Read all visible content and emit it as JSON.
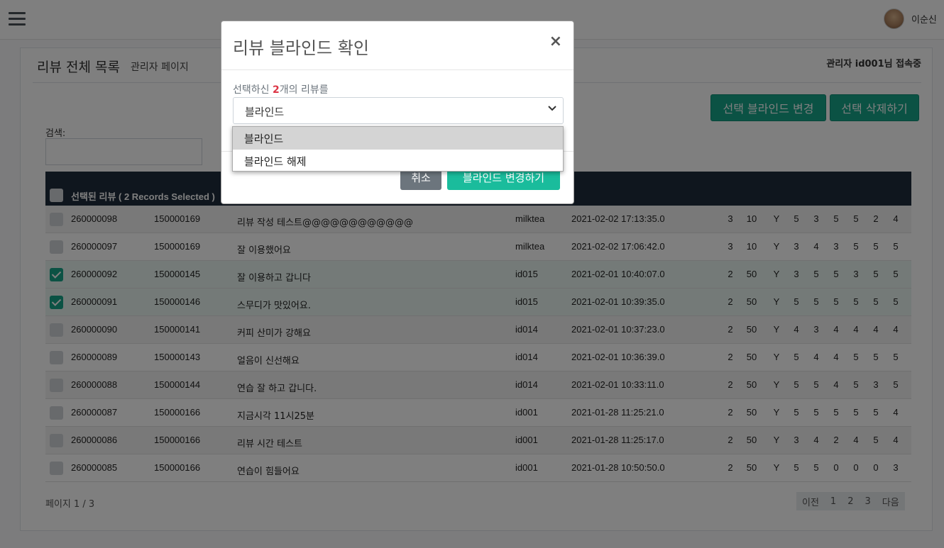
{
  "header": {
    "username": "이순신"
  },
  "page": {
    "title": "리뷰 전체 목록",
    "subtitle": "관리자 페이지",
    "admin_status": "관리자 id001님 접속중",
    "btn_blind_change": "선택 블라인드 변경",
    "btn_delete": "선택 삭제하기",
    "search_label": "검색:"
  },
  "table": {
    "header_label": "선택된 리뷰 ( 2 Records Selected )",
    "rows": [
      {
        "id": "260000098",
        "store": "150000169",
        "text": "리뷰 작성 테스트@@@@@@@@@@@@",
        "user": "milktea",
        "date": "2021-02-02 17:13:35.0",
        "n": [
          "3",
          "10",
          "Y",
          "5",
          "3",
          "5",
          "5",
          "2",
          "4"
        ],
        "selected": false
      },
      {
        "id": "260000097",
        "store": "150000169",
        "text": "잘 이용했어요",
        "user": "milktea",
        "date": "2021-02-02 17:06:42.0",
        "n": [
          "3",
          "10",
          "Y",
          "3",
          "4",
          "3",
          "5",
          "5",
          "5"
        ],
        "selected": false
      },
      {
        "id": "260000092",
        "store": "150000145",
        "text": "잘 이용하고 갑니다",
        "user": "id015",
        "date": "2021-02-01 10:40:07.0",
        "n": [
          "2",
          "50",
          "Y",
          "3",
          "5",
          "5",
          "3",
          "5",
          "5"
        ],
        "selected": true
      },
      {
        "id": "260000091",
        "store": "150000146",
        "text": "스무디가 맛있어요.",
        "user": "id015",
        "date": "2021-02-01 10:39:35.0",
        "n": [
          "2",
          "50",
          "Y",
          "5",
          "5",
          "5",
          "5",
          "5",
          "5"
        ],
        "selected": true
      },
      {
        "id": "260000090",
        "store": "150000141",
        "text": "커피 산미가 강해요",
        "user": "id014",
        "date": "2021-02-01 10:37:23.0",
        "n": [
          "2",
          "50",
          "Y",
          "4",
          "3",
          "4",
          "4",
          "4",
          "4"
        ],
        "selected": false
      },
      {
        "id": "260000089",
        "store": "150000143",
        "text": "얼음이 신선해요",
        "user": "id014",
        "date": "2021-02-01 10:36:39.0",
        "n": [
          "2",
          "50",
          "Y",
          "5",
          "4",
          "4",
          "5",
          "5",
          "5"
        ],
        "selected": false
      },
      {
        "id": "260000088",
        "store": "150000144",
        "text": "연습 잘 하고 갑니다.",
        "user": "id014",
        "date": "2021-02-01 10:33:11.0",
        "n": [
          "2",
          "50",
          "Y",
          "5",
          "5",
          "4",
          "5",
          "3",
          "5"
        ],
        "selected": false
      },
      {
        "id": "260000087",
        "store": "150000166",
        "text": "지금시각 11시25분",
        "user": "id001",
        "date": "2021-01-28 11:25:21.0",
        "n": [
          "2",
          "50",
          "Y",
          "5",
          "5",
          "5",
          "5",
          "5",
          "4"
        ],
        "selected": false
      },
      {
        "id": "260000086",
        "store": "150000166",
        "text": "리뷰 시간 테스트",
        "user": "id001",
        "date": "2021-01-28 11:25:17.0",
        "n": [
          "2",
          "50",
          "Y",
          "3",
          "4",
          "2",
          "4",
          "5",
          "4"
        ],
        "selected": false
      },
      {
        "id": "260000085",
        "store": "150000166",
        "text": "연습이 힘들어요",
        "user": "id001",
        "date": "2021-01-28 10:50:50.0",
        "n": [
          "2",
          "50",
          "Y",
          "5",
          "5",
          "0",
          "0",
          "0",
          "3"
        ],
        "selected": false
      }
    ]
  },
  "pagination": {
    "info": "페이지 1 / 3",
    "prev": "이전",
    "pages": [
      "1",
      "2",
      "3"
    ],
    "next": "다음"
  },
  "modal": {
    "title": "리뷰 블라인드 확인",
    "close": "×",
    "text_prefix": "선택하신 ",
    "count": "2",
    "text_suffix": "개의 리뷰를",
    "select_value": "블라인드",
    "cancel": "취소",
    "confirm": "블라인드 변경하기",
    "options": [
      "블라인드",
      "블라인드 해제"
    ]
  }
}
